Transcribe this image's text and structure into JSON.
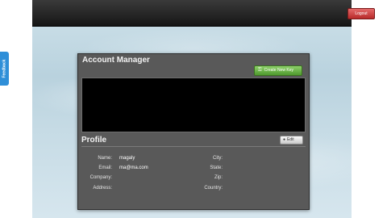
{
  "topbar": {
    "logout_label": "Logout"
  },
  "feedback": {
    "label": "Feedback"
  },
  "account_manager": {
    "title": "Account Manager",
    "create_button_label": "Create New Key"
  },
  "profile": {
    "title": "Profile",
    "edit_label": "Edit",
    "fields": {
      "name": {
        "label": "Name:",
        "value": "magaly"
      },
      "email": {
        "label": "Email:",
        "value": "ma@ma.com"
      },
      "company": {
        "label": "Company:",
        "value": ""
      },
      "address": {
        "label": "Address:",
        "value": ""
      },
      "city": {
        "label": "City:",
        "value": ""
      },
      "state": {
        "label": "State:",
        "value": ""
      },
      "zip": {
        "label": "Zip:",
        "value": ""
      },
      "country": {
        "label": "Country:",
        "value": ""
      }
    }
  },
  "colors": {
    "logout": "#c83a3a",
    "create": "#5aa83a",
    "feedback": "#2f8fd8",
    "panel": "#595959"
  }
}
